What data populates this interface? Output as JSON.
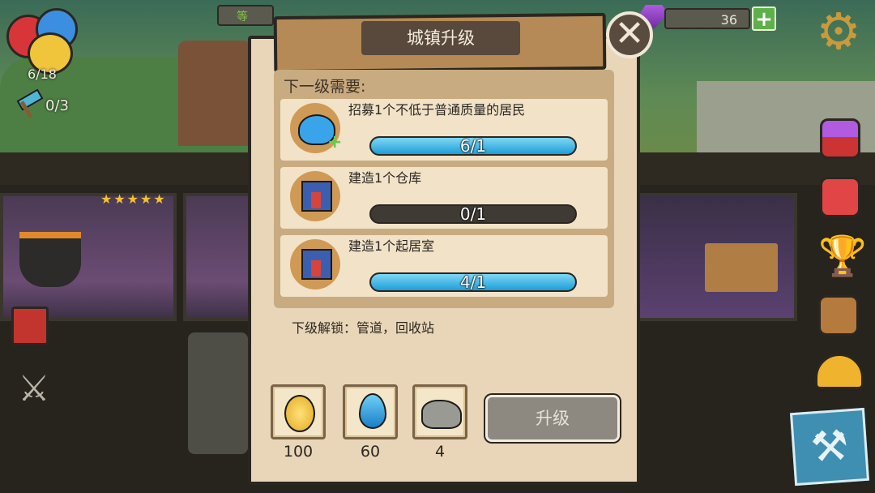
{
  "hud": {
    "slime_count": "6/18",
    "builder_count": "0/3",
    "gem_count": "36",
    "top_left_label": "等"
  },
  "dialog": {
    "title": "城镇升级",
    "requirements_title": "下一级需要:",
    "requirements": [
      {
        "text": "招募1个不低于普通质量的居民",
        "progress_label": "6/1",
        "progress": 1.0,
        "icon": "blue-slime-icon"
      },
      {
        "text": "建造1个仓库",
        "progress_label": "0/1",
        "progress": 0.0,
        "icon": "build-house-icon"
      },
      {
        "text": "建造1个起居室",
        "progress_label": "4/1",
        "progress": 1.0,
        "icon": "build-house-icon"
      }
    ],
    "unlock_text": "下级解锁：管道，回收站",
    "costs": [
      {
        "icon": "gold-coin-icon",
        "amount": "100"
      },
      {
        "icon": "water-drop-icon",
        "amount": "60"
      },
      {
        "icon": "stone-icon",
        "amount": "4"
      }
    ],
    "upgrade_button": "升级"
  },
  "colors": {
    "progress_fill": "#1e9ed8",
    "panel_bg": "#e9d6b9",
    "button_disabled": "#8d8880"
  }
}
